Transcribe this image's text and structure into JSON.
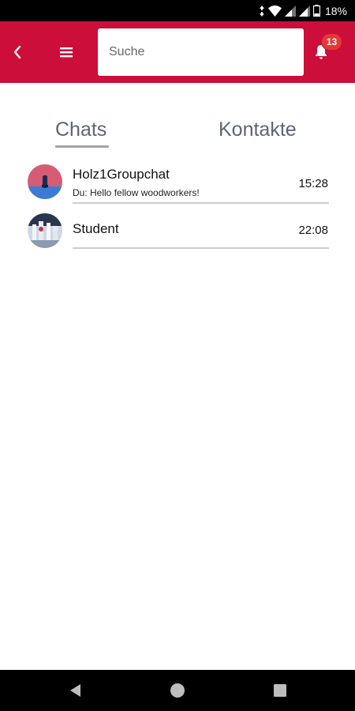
{
  "status_bar": {
    "battery_percent": "18%",
    "icons": [
      "data-arrows-icon",
      "wifi-icon",
      "signal-icon",
      "signal-icon",
      "battery-icon"
    ]
  },
  "app_bar": {
    "background_color": "#cc0e3a",
    "back_icon": "chevron-left-icon",
    "menu_icon": "hamburger-menu-icon",
    "search": {
      "placeholder": "Suche",
      "value": ""
    },
    "notifications": {
      "icon": "bell-icon",
      "count": "13",
      "badge_color": "#e53935"
    }
  },
  "tabs": {
    "items": [
      {
        "label": "Chats",
        "active": true
      },
      {
        "label": "Kontakte",
        "active": false
      }
    ]
  },
  "chats": [
    {
      "name": "Holz1Groupchat",
      "preview": "Du: Hello fellow woodworkers!",
      "time": "15:28"
    },
    {
      "name": "Student",
      "preview": "",
      "time": "22:08"
    }
  ],
  "nav_bar": {
    "icons": [
      "nav-back-icon",
      "nav-home-icon",
      "nav-recent-apps-icon"
    ]
  }
}
